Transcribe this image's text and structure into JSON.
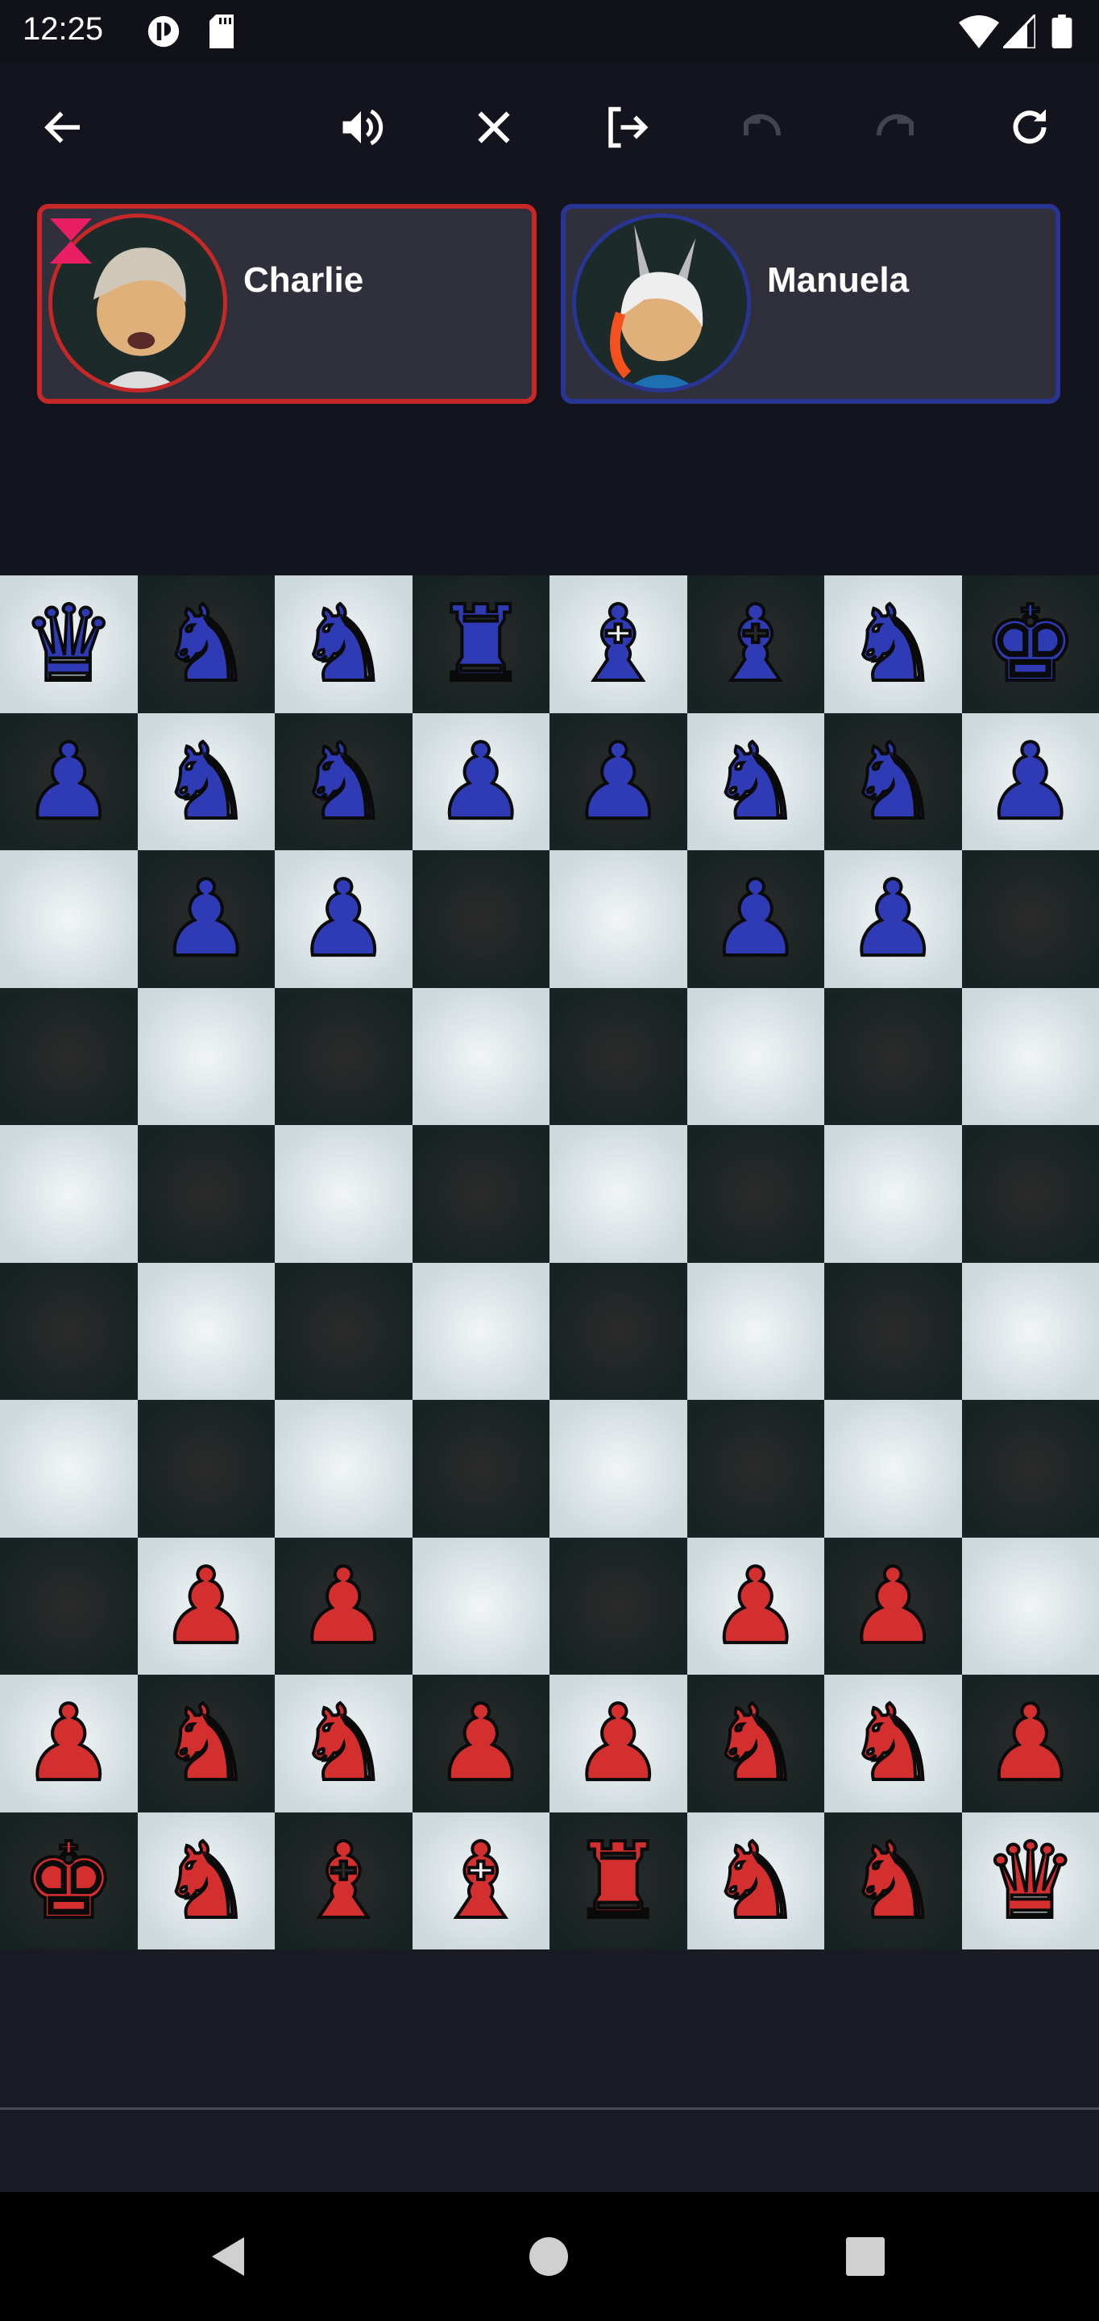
{
  "status_bar": {
    "time": "12:25",
    "icons": [
      "app-notification-icon",
      "sd-card-icon",
      "wifi-icon",
      "cell-signal-icon",
      "battery-icon"
    ]
  },
  "toolbar": {
    "buttons": [
      {
        "name": "back",
        "icon": "arrow-left-icon",
        "enabled": true
      },
      {
        "name": "sound",
        "icon": "volume-icon",
        "enabled": true
      },
      {
        "name": "close",
        "icon": "close-icon",
        "enabled": true
      },
      {
        "name": "exit",
        "icon": "logout-icon",
        "enabled": true
      },
      {
        "name": "undo",
        "icon": "undo-icon",
        "enabled": false
      },
      {
        "name": "redo",
        "icon": "redo-icon",
        "enabled": false
      },
      {
        "name": "restart",
        "icon": "refresh-icon",
        "enabled": true
      }
    ]
  },
  "players": [
    {
      "name": "Charlie",
      "color": "#c62828",
      "active": true,
      "timer_icon": "hourglass-icon"
    },
    {
      "name": "Manuela",
      "color": "#283593",
      "active": false
    }
  ],
  "colors": {
    "blue": "#2f3bb5",
    "red": "#d32f2f",
    "light_square": "#cfd8dc",
    "dark_square": "#182323"
  },
  "board": {
    "columns": 8,
    "rows": [
      [
        "bq",
        "bw",
        "bf",
        "br",
        "bb",
        "bb",
        "bn",
        "bk"
      ],
      [
        "bp",
        "bh",
        "bh",
        "bp",
        "bp",
        "bh",
        "bh",
        "bp"
      ],
      [
        "",
        "bp",
        "bp",
        "",
        "",
        "bp",
        "bp",
        ""
      ],
      [
        "",
        "",
        "",
        "",
        "",
        "",
        "",
        ""
      ],
      [
        "",
        "",
        "",
        "",
        "",
        "",
        "",
        ""
      ],
      [
        "",
        "",
        "",
        "",
        "",
        "",
        "",
        ""
      ],
      [
        "",
        "",
        "",
        "",
        "",
        "",
        "",
        ""
      ],
      [
        "",
        "rp",
        "rp",
        "",
        "",
        "rp",
        "rp",
        ""
      ],
      [
        "rp",
        "rh",
        "rh",
        "rp",
        "rp",
        "rh",
        "rh",
        "rp"
      ],
      [
        "rk",
        "rn",
        "rb",
        "rb",
        "rr",
        "rf",
        "rw",
        "rq"
      ]
    ],
    "piece_types": {
      "q": "queen",
      "k": "king",
      "r": "rook",
      "b": "bishop",
      "n": "knight",
      "p": "pawn",
      "w": "wolf",
      "f": "fox",
      "h": "hoplite"
    }
  },
  "nav": [
    "back-triangle-icon",
    "home-circle-icon",
    "recents-square-icon"
  ]
}
